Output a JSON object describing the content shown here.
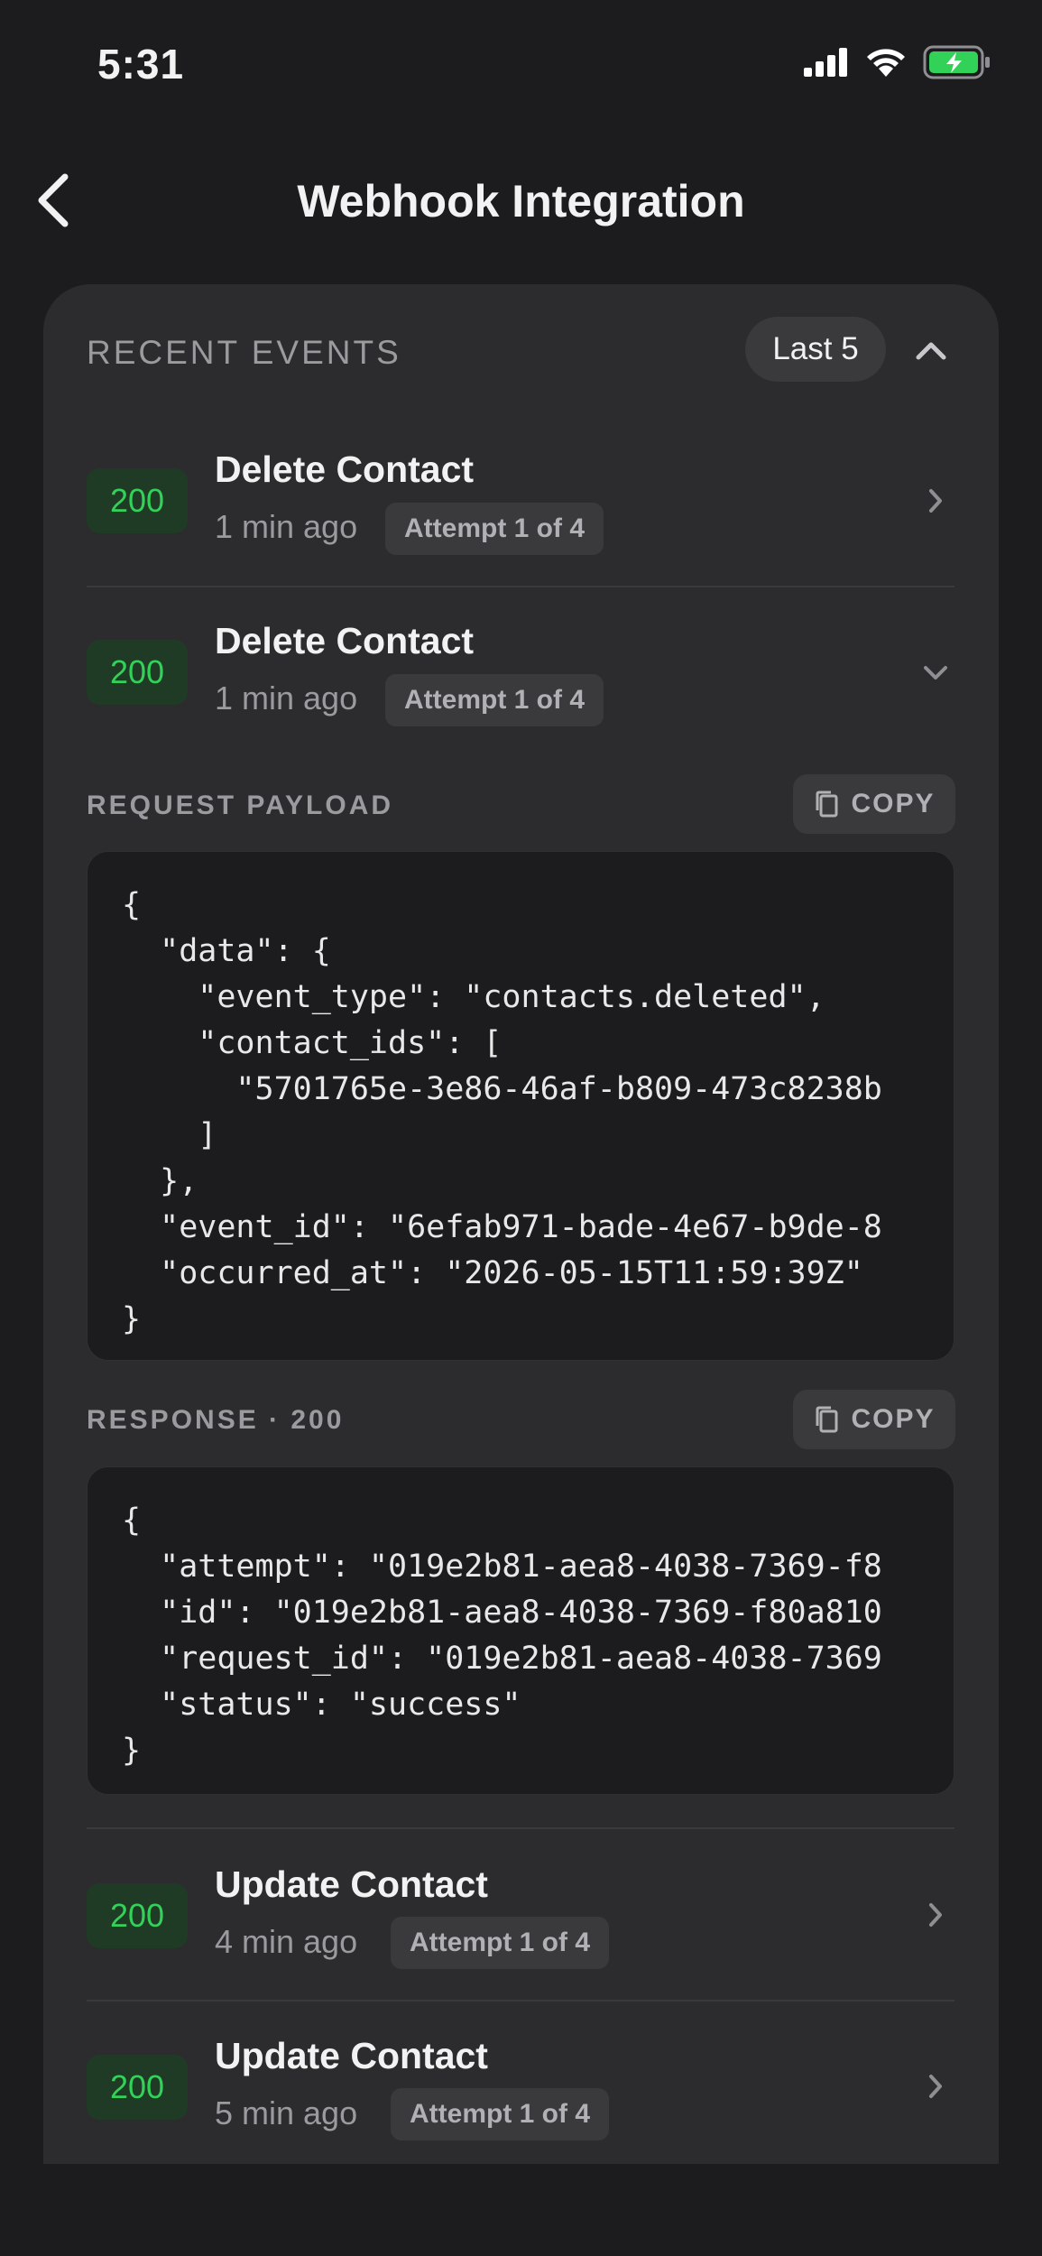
{
  "status_bar": {
    "time": "5:31"
  },
  "header": {
    "title": "Webhook Integration"
  },
  "events_section": {
    "title": "RECENT EVENTS",
    "filter_label": "Last 5"
  },
  "events": [
    {
      "status": "200",
      "title": "Delete Contact",
      "time": "1 min ago",
      "attempt": "Attempt 1 of 4"
    },
    {
      "status": "200",
      "title": "Delete Contact",
      "time": "1 min ago",
      "attempt": "Attempt 1 of 4"
    },
    {
      "status": "200",
      "title": "Update Contact",
      "time": "4 min ago",
      "attempt": "Attempt 1 of 4"
    },
    {
      "status": "200",
      "title": "Update Contact",
      "time": "5 min ago",
      "attempt": "Attempt 1 of 4"
    }
  ],
  "request": {
    "label": "REQUEST PAYLOAD",
    "copy_label": "COPY",
    "code": "{\n  \"data\": {\n    \"event_type\": \"contacts.deleted\",\n    \"contact_ids\": [\n      \"5701765e-3e86-46af-b809-473c8238b\n    ]\n  },\n  \"event_id\": \"6efab971-bade-4e67-b9de-8\n  \"occurred_at\": \"2026-05-15T11:59:39Z\"\n}"
  },
  "response": {
    "label": "RESPONSE · 200",
    "copy_label": "COPY",
    "code": "{\n  \"attempt\": \"019e2b81-aea8-4038-7369-f8\n  \"id\": \"019e2b81-aea8-4038-7369-f80a810\n  \"request_id\": \"019e2b81-aea8-4038-7369\n  \"status\": \"success\"\n}"
  },
  "colors": {
    "background": "#1c1c1e",
    "card": "#2c2c2e",
    "success_green": "#32d158",
    "badge_bg": "#1f3a25",
    "battery_green": "#32d158"
  },
  "icons": {
    "back": "chevron-left-icon",
    "collapse": "chevron-up-icon",
    "row_collapsed": "chevron-right-icon",
    "row_expanded": "chevron-down-icon",
    "copy": "copy-icon"
  }
}
